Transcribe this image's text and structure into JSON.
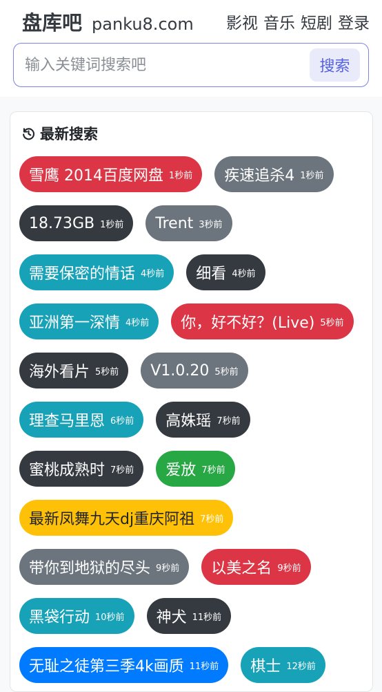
{
  "header": {
    "brand_name": "盘库吧",
    "brand_domain": "panku8.com",
    "nav": [
      "影视",
      "音乐",
      "短剧",
      "登录"
    ]
  },
  "search": {
    "placeholder": "输入关键词搜索吧",
    "button_label": "搜索"
  },
  "recent": {
    "title": "最新搜索",
    "icon": "history-icon",
    "colors": {
      "red": "#dc3545",
      "gray": "#6c757d",
      "dark": "#343a40",
      "teal": "#17a2b8",
      "green": "#28a745",
      "yellow": "#ffc107",
      "blue": "#007bff"
    },
    "items": [
      {
        "term": "雪鹰 2014百度网盘",
        "time": "1秒前",
        "color": "red"
      },
      {
        "term": "疾速追杀4",
        "time": "1秒前",
        "color": "gray"
      },
      {
        "term": "18.73GB",
        "time": "1秒前",
        "color": "dark"
      },
      {
        "term": "Trent",
        "time": "3秒前",
        "color": "gray"
      },
      {
        "term": "需要保密的情话",
        "time": "4秒前",
        "color": "teal"
      },
      {
        "term": "细看",
        "time": "4秒前",
        "color": "dark"
      },
      {
        "term": "亚洲第一深情",
        "time": "4秒前",
        "color": "teal"
      },
      {
        "term": "你，好不好？(Live)",
        "time": "5秒前",
        "color": "red"
      },
      {
        "term": "海外看片",
        "time": "5秒前",
        "color": "dark"
      },
      {
        "term": "V1.0.20",
        "time": "5秒前",
        "color": "gray"
      },
      {
        "term": "理查马里恩",
        "time": "6秒前",
        "color": "teal"
      },
      {
        "term": "高姝瑶",
        "time": "7秒前",
        "color": "dark"
      },
      {
        "term": "蜜桃成熟时",
        "time": "7秒前",
        "color": "dark"
      },
      {
        "term": "爱放",
        "time": "7秒前",
        "color": "green"
      },
      {
        "term": "最新凤舞九天dj重庆阿祖",
        "time": "7秒前",
        "color": "yellow"
      },
      {
        "term": "带你到地狱的尽头",
        "time": "9秒前",
        "color": "gray"
      },
      {
        "term": "以美之名",
        "time": "9秒前",
        "color": "red"
      },
      {
        "term": "黑袋行动",
        "time": "10秒前",
        "color": "teal"
      },
      {
        "term": "神犬",
        "time": "11秒前",
        "color": "dark"
      },
      {
        "term": "无耻之徒第三季4k画质",
        "time": "11秒前",
        "color": "blue"
      },
      {
        "term": "棋士",
        "time": "12秒前",
        "color": "teal"
      }
    ]
  }
}
